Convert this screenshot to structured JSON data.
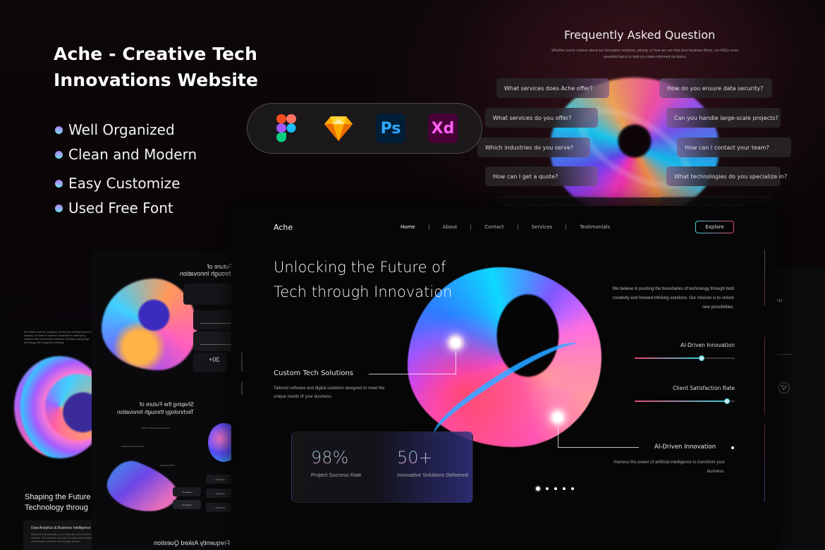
{
  "promo": {
    "title": "Ache - Creative Tech Innovations Website",
    "features": [
      "Well Organized",
      "Clean and Modern",
      "Easy Customize",
      "Used Free Font"
    ],
    "tools": [
      {
        "name": "Figma",
        "icon": "figma-icon"
      },
      {
        "name": "Sketch",
        "icon": "sketch-icon"
      },
      {
        "name": "Photoshop",
        "icon": "photoshop-icon",
        "label": "Ps"
      },
      {
        "name": "Adobe XD",
        "icon": "adobe-xd-icon",
        "label": "Xd"
      }
    ]
  },
  "faq": {
    "title": "Frequently Asked Question",
    "subtitle": "Whether you're curious about our innovative solutions, pricing, or how we can help your business thrive, our FAQs cover essential topics to help you make informed decisions.",
    "questions_left": [
      "What services does Ache offer?",
      "What services do you offer?",
      "Which industries do you serve?",
      "How can I get a quote?",
      "Do you offer post-delivery support?"
    ],
    "questions_right": [
      "How do you ensure data security?",
      "Can you handle large-scale projects?",
      "How can I contact your team?",
      "What technologies do you specialize in?",
      "What makes Ache different?"
    ]
  },
  "main": {
    "logo": "Ache",
    "nav": [
      "Home",
      "About",
      "Contact",
      "Services",
      "Testimonials"
    ],
    "nav_active": "Home",
    "explore_label": "Explore",
    "hero_title": "Unlocking the Future of Tech through Innovation",
    "callout": {
      "title": "Custom Tech Solutions",
      "description": "Tailored software and digital solutions designed to meet the unique needs of your business."
    },
    "stats": [
      {
        "value": "98%",
        "label": "Project Success Rate"
      },
      {
        "value": "50+",
        "label": "Innovative Solutions Delivered"
      }
    ],
    "about": "We believe in pushing the boundaries of technology through bold creativity and forward-thinking solutions. Our mission is to unlock new possibilities.",
    "progress": [
      {
        "label": "AI-Driven Innovation",
        "percent": 67
      },
      {
        "label": "Client Satisfaction Rate",
        "percent": 92
      }
    ],
    "ai_feature": {
      "title": "AI-Driven Innovation",
      "description": "Harness the power of artificial intelligence to transform your business."
    },
    "carousel": {
      "count": 5,
      "active": 0
    }
  },
  "mock_left": {
    "intro": "We believe that true innovation comes from thinking beyond the ordinary. Our team of experts is dedicated to developing solutions that revolutionize industries, blending cutting-edge technology with imaginative thinking.",
    "heading_line1": "Shaping the Future",
    "heading_line2": "Technology throug",
    "card_title": "Data Analytics & Business Intelligence",
    "card_desc": "Unlock the full potential of your data with robust Data Analytics services. We transform raw data into actionable insights that drive smarter decisions and strategic growth."
  },
  "mock_mid": {
    "heading_top_1": "Future of",
    "heading_top_2": "through Innovation",
    "stat": "30+",
    "heading_mid_1": "Shaping the Future of",
    "heading_mid_2": "Technology through Innovation",
    "items": [
      "Innovation starts with creativity",
      "E-Commerce Solutions",
      "CMS Integration"
    ],
    "chip_label": "Logoipsum",
    "faq_heading": "Frequently Asked Question"
  },
  "mock_right": {
    "text": "Us"
  }
}
